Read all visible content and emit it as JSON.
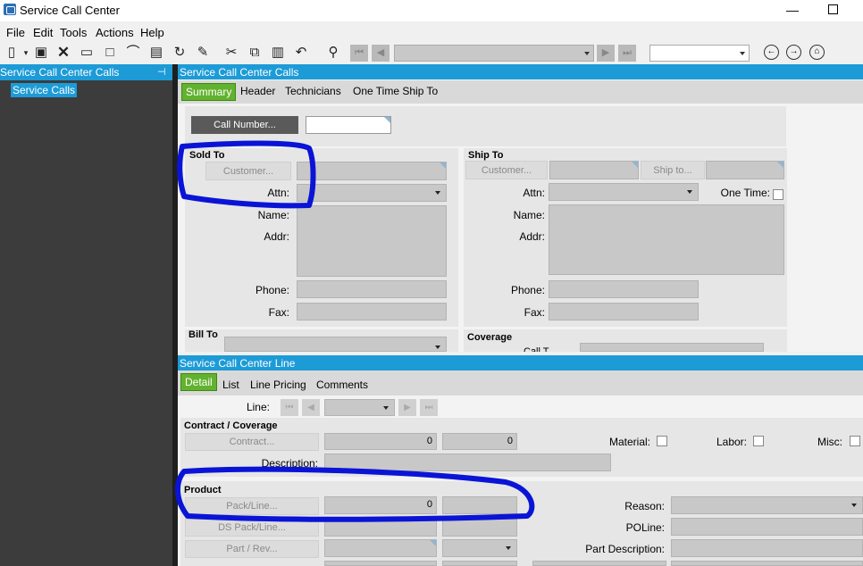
{
  "window": {
    "title": "Service Call Center",
    "minimize": "—"
  },
  "menu": [
    "File",
    "Edit",
    "Tools",
    "Actions",
    "Help"
  ],
  "left_panel": {
    "title": "Service Call Center Calls",
    "pin": "⊣",
    "tree_item": "Service Calls"
  },
  "calls_section": {
    "title": "Service Call Center Calls",
    "tabs": [
      "Summary",
      "Header",
      "Technicians",
      "One Time Ship To"
    ],
    "call_number_button": "Call Number...",
    "sold_to": {
      "title": "Sold To",
      "customer_button": "Customer...",
      "attn": "Attn:",
      "name": "Name:",
      "addr": "Addr:",
      "phone": "Phone:",
      "fax": "Fax:"
    },
    "ship_to": {
      "title": "Ship To",
      "customer_button": "Customer...",
      "ship_to_button": "Ship to...",
      "attn": "Attn:",
      "one_time": "One Time:",
      "name": "Name:",
      "addr": "Addr:",
      "phone": "Phone:",
      "fax": "Fax:"
    },
    "bill_to": {
      "title": "Bill To"
    },
    "coverage": {
      "title": "Coverage",
      "call_type_partial": "Call T"
    }
  },
  "line_section": {
    "title": "Service Call Center Line",
    "tabs": [
      "Detail",
      "List",
      "Line Pricing",
      "Comments"
    ],
    "line_label": "Line:",
    "contract_group": "Contract / Coverage",
    "contract_button": "Contract...",
    "contract_value_1": "0",
    "contract_value_2": "0",
    "material": "Material:",
    "labor": "Labor:",
    "misc": "Misc:",
    "description": "Description:",
    "product_group": "Product",
    "pack_line_button": "Pack/Line...",
    "pack_line_value": "0",
    "ds_pack_line_button": "DS Pack/Line...",
    "part_rev_button": "Part / Rev...",
    "reason": "Reason:",
    "poline": "POLine:",
    "part_description": "Part Description:"
  },
  "colors": {
    "accent": "#1d9bd7",
    "active_tab": "#62b22f",
    "annotation": "#0a14d6"
  }
}
